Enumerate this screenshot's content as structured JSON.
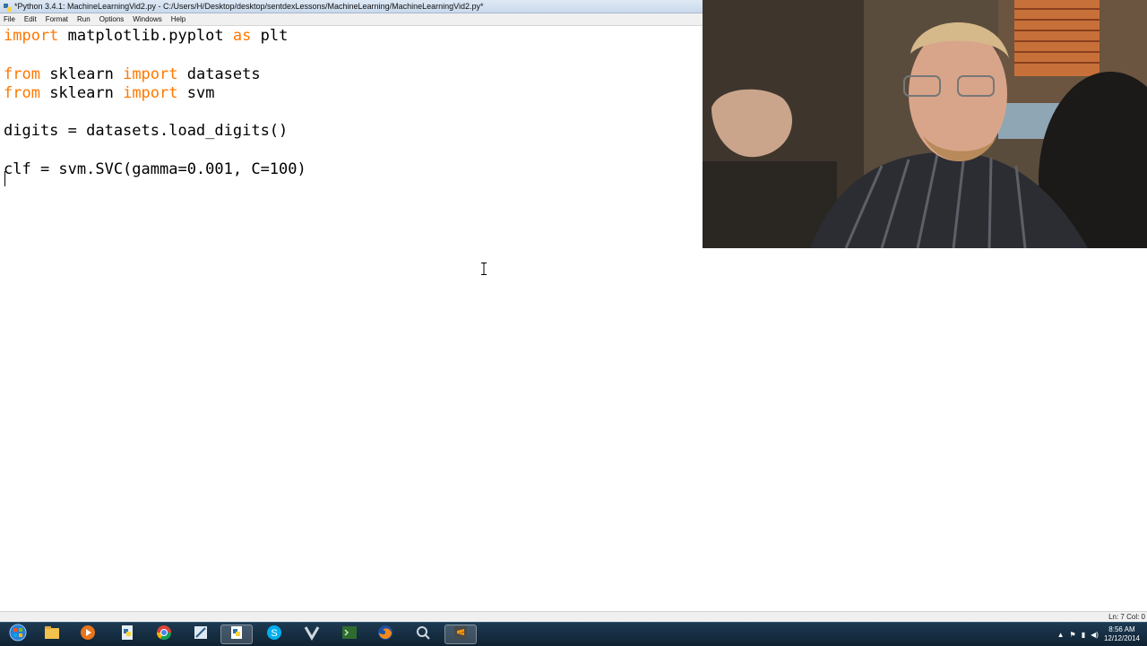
{
  "window": {
    "title": "*Python 3.4.1: MachineLearningVid2.py - C:/Users/H/Desktop/desktop/sentdexLessons/MachineLearning/MachineLearningVid2.py*"
  },
  "menubar": {
    "items": [
      "File",
      "Edit",
      "Format",
      "Run",
      "Options",
      "Windows",
      "Help"
    ]
  },
  "editor": {
    "lines": [
      {
        "kw1": "import",
        "t1": " matplotlib.pyplot ",
        "kw2": "as",
        "t2": " plt"
      },
      {
        "kw1": "",
        "t1": "",
        "kw2": "",
        "t2": ""
      },
      {
        "kw1": "from",
        "t1": " sklearn ",
        "kw2": "import",
        "t2": " datasets"
      },
      {
        "kw1": "from",
        "t1": " sklearn ",
        "kw2": "import",
        "t2": " svm"
      },
      {
        "kw1": "",
        "t1": "",
        "kw2": "",
        "t2": ""
      },
      {
        "kw1": "",
        "t1": "digits = datasets.load_digits()",
        "kw2": "",
        "t2": ""
      },
      {
        "kw1": "",
        "t1": "",
        "kw2": "",
        "t2": ""
      },
      {
        "kw1": "",
        "t1": "clf = svm.SVC(gamma=0.001, C=100)",
        "kw2": "",
        "t2": ""
      }
    ],
    "keyword_color": "#ff7700"
  },
  "statusbar": {
    "position": "Ln: 7 Col: 0"
  },
  "taskbar": {
    "apps": [
      "start-orb-icon",
      "file-explorer-icon",
      "media-player-icon",
      "python-file-icon",
      "chrome-icon",
      "editor-icon",
      "idle-icon",
      "skype-icon",
      "vim-icon",
      "terminal-icon",
      "firefox-icon",
      "search-app-icon",
      "sublime-icon"
    ],
    "clock_time": "8:56 AM",
    "clock_date": "12/12/2014"
  }
}
